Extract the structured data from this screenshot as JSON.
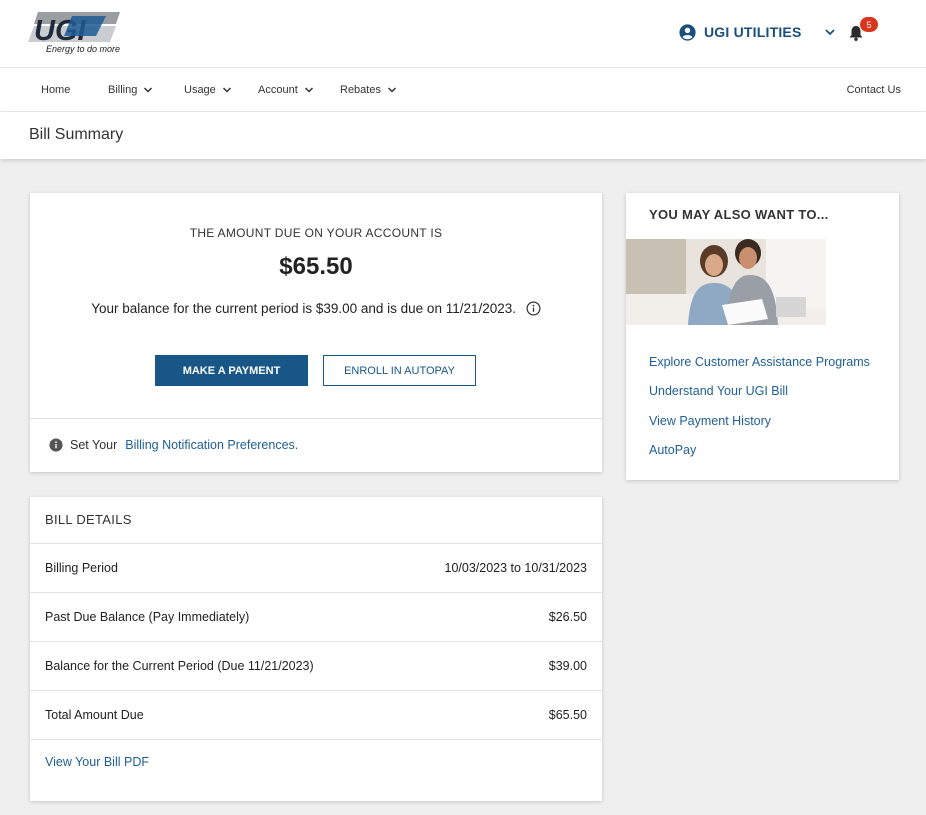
{
  "header": {
    "logo_text": "UGI",
    "logo_tagline": "Energy to do more",
    "account_name": "UGI UTILITIES",
    "notification_count": "5"
  },
  "nav": {
    "items": [
      {
        "label": "Home"
      },
      {
        "label": "Billing"
      },
      {
        "label": "Usage"
      },
      {
        "label": "Account"
      },
      {
        "label": "Rebates"
      }
    ],
    "contact_label": "Contact Us"
  },
  "page": {
    "title": "Bill Summary"
  },
  "amount_card": {
    "heading": "THE AMOUNT DUE ON YOUR ACCOUNT IS",
    "amount": "$65.50",
    "balance_text": "Your balance for the current period is $39.00 and is due on 11/21/2023.",
    "make_payment_label": "MAKE A PAYMENT",
    "autopay_label": "ENROLL IN AUTOPAY",
    "pref_prefix": "Set Your",
    "pref_link": "Billing Notification Preferences."
  },
  "bill_details": {
    "heading": "BILL DETAILS",
    "rows": [
      {
        "label": "Billing Period",
        "value": "10/03/2023 to 10/31/2023"
      },
      {
        "label": "Past Due Balance (Pay Immediately)",
        "value": "$26.50"
      },
      {
        "label": "Balance for the Current Period (Due 11/21/2023)",
        "value": "$39.00"
      },
      {
        "label": "Total Amount Due",
        "value": "$65.50"
      }
    ],
    "pdf_link": "View Your Bill PDF"
  },
  "side": {
    "heading": "YOU MAY ALSO WANT TO...",
    "links": [
      {
        "label": "Explore Customer Assistance Programs"
      },
      {
        "label": "Understand Your UGI Bill"
      },
      {
        "label": "View Payment History"
      },
      {
        "label": "AutoPay"
      }
    ]
  },
  "colors": {
    "brand_blue": "#175687",
    "link_blue": "#1f5f97",
    "badge_red": "#d9361e",
    "page_bg": "#efefef"
  }
}
